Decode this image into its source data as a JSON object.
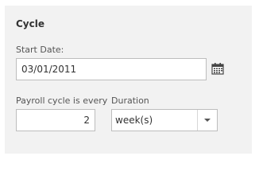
{
  "section": {
    "title": "Cycle"
  },
  "start_date": {
    "label": "Start Date:",
    "value": "03/01/2011",
    "icon": "calendar-icon"
  },
  "payroll_cycle": {
    "label": "Payroll cycle is every",
    "value": "2"
  },
  "duration": {
    "label": "Duration",
    "selected": "week(s)",
    "icon": "chevron-down-icon"
  }
}
